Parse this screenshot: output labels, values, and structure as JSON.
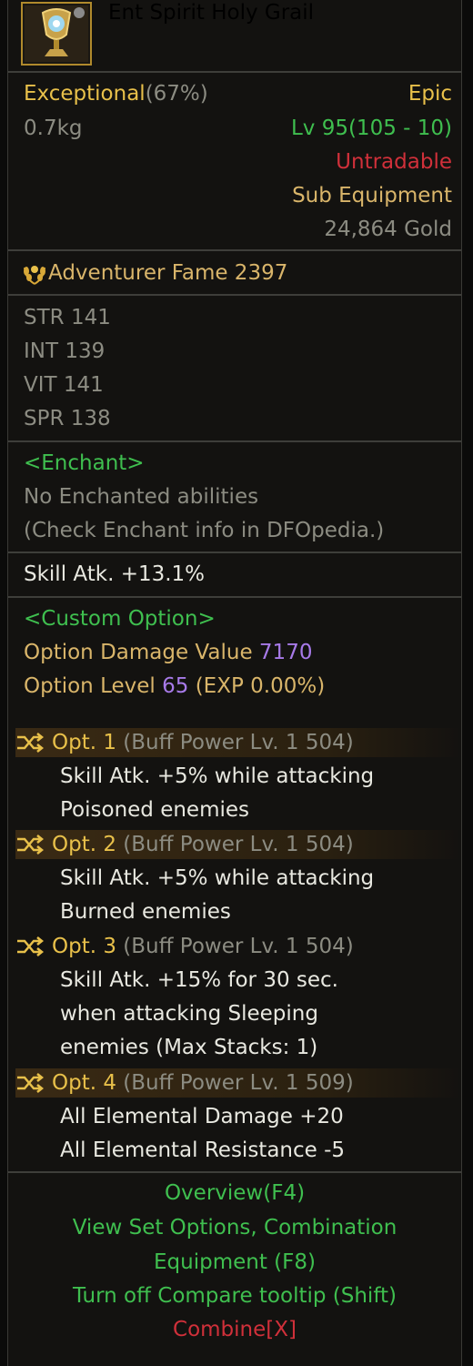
{
  "item": {
    "name": "Ent Spirit Holy Grail",
    "quality_label": "Exceptional",
    "quality_pct": "(67%)",
    "rarity": "Epic",
    "weight": "0.7kg",
    "level": "Lv 95(105 - 10)",
    "trade_status": "Untradable",
    "slot_type": "Sub Equipment",
    "price": "24,864 Gold"
  },
  "fame": {
    "label": "Adventurer Fame 2397"
  },
  "stats": [
    "STR 141",
    "INT 139",
    "VIT 141",
    "SPR 138"
  ],
  "enchant": {
    "header": "<Enchant>",
    "line1": "No Enchanted abilities",
    "line2": "(Check Enchant info in DFOpedia.)"
  },
  "skill_atk": "Skill Atk. +13.1%",
  "custom_option": {
    "header": "<Custom Option>",
    "damage_label": "Option Damage Value",
    "damage_value": "7170",
    "level_label": "Option Level",
    "level_value": "65",
    "exp": "(EXP 0.00%)"
  },
  "options": [
    {
      "label": "Opt. 1",
      "buff": "(Buff Power Lv. 1 504)",
      "lines": [
        "Skill Atk. +5% while attacking",
        "Poisoned enemies"
      ]
    },
    {
      "label": "Opt. 2",
      "buff": "(Buff Power Lv. 1 504)",
      "lines": [
        "Skill Atk. +5% while attacking",
        "Burned enemies"
      ]
    },
    {
      "label": "Opt. 3",
      "buff": "(Buff Power Lv. 1 504)",
      "lines": [
        "Skill Atk. +15% for 30 sec.",
        "when attacking Sleeping",
        "enemies (Max Stacks: 1)"
      ]
    },
    {
      "label": "Opt. 4",
      "buff": "(Buff Power Lv. 1 509)",
      "lines": [
        "All Elemental Damage +20",
        "All Elemental Resistance -5"
      ]
    }
  ],
  "footer": {
    "overview": "Overview(F4)",
    "view_set_1": "View Set Options, Combination",
    "view_set_2": "Equipment (F8)",
    "compare": "Turn off Compare tooltip (Shift)",
    "combine": "Combine[X]"
  },
  "colors": {
    "gold": "#e8c04a",
    "green": "#3fbf4f",
    "red": "#d0303a",
    "purple": "#a77ae8",
    "grey": "#8c8c82"
  },
  "icons": {
    "item": "holy-grail-icon",
    "fame": "laurel-icon",
    "option": "shuffle-icon"
  }
}
